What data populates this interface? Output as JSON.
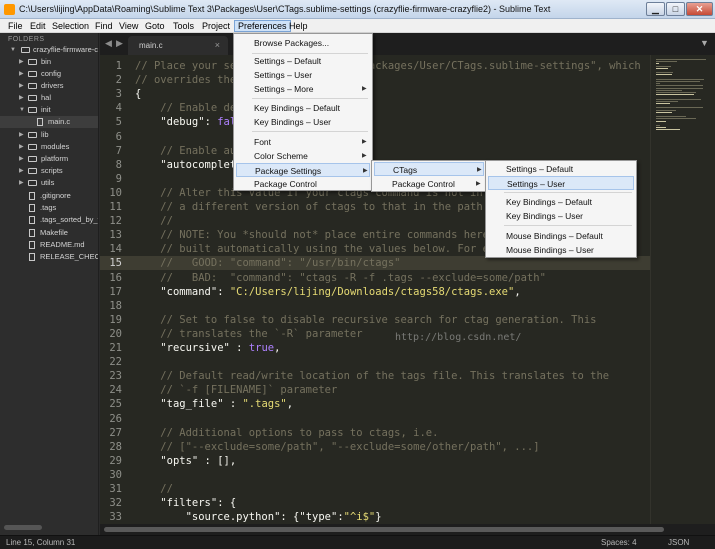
{
  "window": {
    "title": "C:\\Users\\lijing\\AppData\\Roaming\\Sublime Text 3\\Packages\\User\\CTags.sublime-settings (crazyflie-firmware-crazyflie2) - Sublime Text",
    "min_label": "▁",
    "max_label": "□",
    "close_label": "✕"
  },
  "menubar": [
    "File",
    "Edit",
    "Selection",
    "Find",
    "View",
    "Goto",
    "Tools",
    "Project",
    "Preferences",
    "Help"
  ],
  "sidebar": {
    "heading": "FOLDERS",
    "items": [
      {
        "label": "crazyflie-firmware-cr",
        "kind": "folder",
        "open": true
      },
      {
        "label": "bin",
        "kind": "folder"
      },
      {
        "label": "config",
        "kind": "folder"
      },
      {
        "label": "drivers",
        "kind": "folder"
      },
      {
        "label": "hal",
        "kind": "folder"
      },
      {
        "label": "init",
        "kind": "folder",
        "open": true
      },
      {
        "label": "main.c",
        "kind": "file"
      },
      {
        "label": "lib",
        "kind": "folder"
      },
      {
        "label": "modules",
        "kind": "folder"
      },
      {
        "label": "platform",
        "kind": "folder"
      },
      {
        "label": "scripts",
        "kind": "folder"
      },
      {
        "label": "utils",
        "kind": "folder"
      },
      {
        "label": ".gitignore",
        "kind": "file"
      },
      {
        "label": ".tags",
        "kind": "file"
      },
      {
        "label": ".tags_sorted_by_fi",
        "kind": "file"
      },
      {
        "label": "Makefile",
        "kind": "file"
      },
      {
        "label": "README.md",
        "kind": "file"
      },
      {
        "label": "RELEASE_CHECKLI",
        "kind": "file"
      }
    ]
  },
  "tabs": {
    "nav_prev": "◀",
    "nav_next": "▶",
    "active": "main.c",
    "close": "×",
    "dropdown": "▼"
  },
  "editor": {
    "lines": [
      {
        "n": "1",
        "t": "// Place your settings in the file \"Packages/User/CTags.sublime-settings\", which",
        "cls": "c"
      },
      {
        "n": "2",
        "t": "// overrides the settings in here.",
        "cls": "c"
      },
      {
        "n": "3",
        "t": "{",
        "cls": "p"
      },
      {
        "n": "4",
        "t": "    // Enable debugging.",
        "cls": "c"
      },
      {
        "n": "5",
        "t": "    \"debug\": false,",
        "cls": "mix"
      },
      {
        "n": "6",
        "t": "",
        "cls": "p"
      },
      {
        "n": "7",
        "t": "    // Enable auto-complete.",
        "cls": "c"
      },
      {
        "n": "8",
        "t": "    \"autocomplete\": false,",
        "cls": "mix"
      },
      {
        "n": "9",
        "t": "",
        "cls": "p"
      },
      {
        "n": "10",
        "t": "    // Alter this value if your ctags command is not in the PATH, or if using",
        "cls": "c"
      },
      {
        "n": "11",
        "t": "    // a different version of ctags to that in the path (i.e. for OSX).",
        "cls": "c"
      },
      {
        "n": "12",
        "t": "    //",
        "cls": "c"
      },
      {
        "n": "13",
        "t": "    // NOTE: You *should not* place entire commands here. These commands are",
        "cls": "c"
      },
      {
        "n": "14",
        "t": "    // built automatically using the values below. For example, this is OK:",
        "cls": "c"
      },
      {
        "n": "15",
        "t": "    //   GOOD: \"command\": \"/usr/bin/ctags\"",
        "cls": "c"
      },
      {
        "n": "16",
        "t": "    //   BAD:  \"command\": \"ctags -R -f .tags --exclude=some/path\"",
        "cls": "c"
      },
      {
        "n": "17",
        "t": "    \"command\": \"C:/Users/lijing/Downloads/ctags58/ctags.exe\",",
        "cls": "mix"
      },
      {
        "n": "18",
        "t": "",
        "cls": "p"
      },
      {
        "n": "19",
        "t": "    // Set to false to disable recursive search for ctag generation. This",
        "cls": "c"
      },
      {
        "n": "20",
        "t": "    // translates the `-R` parameter",
        "cls": "c"
      },
      {
        "n": "21",
        "t": "    \"recursive\" : true,",
        "cls": "mix"
      },
      {
        "n": "22",
        "t": "",
        "cls": "p"
      },
      {
        "n": "23",
        "t": "    // Default read/write location of the tags file. This translates to the",
        "cls": "c"
      },
      {
        "n": "24",
        "t": "    // `-f [FILENAME]` parameter",
        "cls": "c"
      },
      {
        "n": "25",
        "t": "    \"tag_file\" : \".tags\",",
        "cls": "mix"
      },
      {
        "n": "26",
        "t": "",
        "cls": "p"
      },
      {
        "n": "27",
        "t": "    // Additional options to pass to ctags, i.e.",
        "cls": "c"
      },
      {
        "n": "28",
        "t": "    // [\"--exclude=some/path\", \"--exclude=some/other/path\", ...]",
        "cls": "c"
      },
      {
        "n": "29",
        "t": "    \"opts\" : [],",
        "cls": "mix"
      },
      {
        "n": "30",
        "t": "",
        "cls": "p"
      },
      {
        "n": "31",
        "t": "    //",
        "cls": "c"
      },
      {
        "n": "32",
        "t": "    \"filters\": {",
        "cls": "mix"
      },
      {
        "n": "33",
        "t": "        \"source.python\": {\"type\":\"^i$\"}",
        "cls": "mix"
      }
    ],
    "current_line": "15",
    "watermark": "http://blog.csdn.net/"
  },
  "status": {
    "position": "Line 15, Column 31",
    "spaces": "Spaces: 4",
    "syntax": "JSON"
  },
  "menus": {
    "preferences": [
      {
        "label": "Browse Packages..."
      },
      {
        "label": "Settings – Default"
      },
      {
        "label": "Settings – User"
      },
      {
        "label": "Settings – More",
        "sub": true
      },
      {
        "label": "Key Bindings – Default"
      },
      {
        "label": "Key Bindings – User"
      },
      {
        "label": "Font",
        "sub": true
      },
      {
        "label": "Color Scheme",
        "sub": true
      },
      {
        "label": "Package Settings",
        "sub": true,
        "hl": true
      },
      {
        "label": "Package Control"
      }
    ],
    "package_settings": [
      {
        "label": "CTags",
        "sub": true,
        "hl": true
      },
      {
        "label": "Package Control",
        "sub": true
      }
    ],
    "ctags": [
      {
        "label": "Settings – Default"
      },
      {
        "label": "Settings – User",
        "hl": true
      },
      {
        "label": "Key Bindings – Default"
      },
      {
        "label": "Key Bindings – User"
      },
      {
        "label": "Mouse Bindings – Default"
      },
      {
        "label": "Mouse Bindings – User"
      }
    ],
    "submenu_arrow": "▶"
  }
}
